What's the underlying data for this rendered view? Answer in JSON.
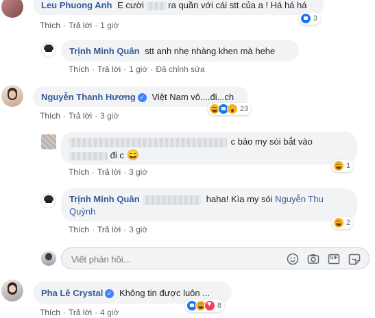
{
  "actions": {
    "like": "Thích",
    "reply": "Trả lời",
    "edited": "Đã chỉnh sửa"
  },
  "comments": [
    {
      "author": "Leu Phuong Anh",
      "text_a": "E cười",
      "text_b": "ra quần với cái stt của a ! Há há há",
      "time": "1 giờ",
      "reaction_count": "3"
    },
    {
      "author": "Trịnh Minh Quân",
      "text": "stt anh nhẹ nhàng khen mà hehe",
      "time": "1 giờ"
    },
    {
      "author": "Nguyễn Thanh Hương",
      "text": "Việt Nam vô....đi...ch",
      "time": "3 giờ",
      "reaction_count": "23"
    },
    {
      "text_a": "c bảo my sói bắt vào",
      "text_b": "đi c",
      "time": "3 giờ",
      "reaction_count": "1"
    },
    {
      "author": "Trịnh Minh Quân",
      "text_a": "haha! Kìa my sói",
      "mention_a": "Nguyễn Thu",
      "mention_b": "Quỳnh",
      "time": "3 giờ",
      "reaction_count": "2"
    },
    {
      "author": "Pha Lê Crystal",
      "text": "Không tin được luôn ...",
      "time": "4 giờ",
      "reaction_count": "8"
    }
  ],
  "reply_input": {
    "placeholder": "Viết phản hồi..."
  },
  "input_tools": {
    "gif_label": "GIF"
  },
  "emoji": {
    "smile": "😄"
  }
}
